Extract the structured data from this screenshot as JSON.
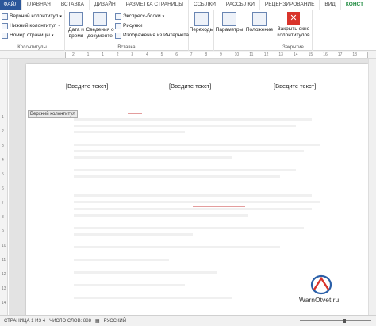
{
  "tabs": [
    "ФАЙЛ",
    "ГЛАВНАЯ",
    "ВСТАВКА",
    "ДИЗАЙН",
    "РАЗМЕТКА СТРАНИЦЫ",
    "ССЫЛКИ",
    "РАССЫЛКИ",
    "РЕЦЕНЗИРОВАНИЕ",
    "ВИД",
    "КОНСТ"
  ],
  "ribbon": {
    "kolontituly": {
      "label": "Колонтитулы",
      "items": [
        "Верхний колонтитул",
        "Нижний колонтитул",
        "Номер страницы"
      ]
    },
    "vstavka": {
      "label": "Вставка",
      "date_time": "Дата и время",
      "doc_info": "Сведения о документе",
      "express": "Экспресс-блоки",
      "pictures": "Рисунки",
      "online_images": "Изображения из Интернета"
    },
    "navigation": {
      "transitions": "Переходы"
    },
    "parameters": "Параметры",
    "position": "Положение",
    "close": {
      "label": "Закрыть окно колонтитулов",
      "group": "Закрытие"
    }
  },
  "ruler": {
    "ticks": [
      "2",
      "1",
      "1",
      "2",
      "3",
      "4",
      "5",
      "6",
      "7",
      "8",
      "9",
      "10",
      "11",
      "12",
      "13",
      "14",
      "15",
      "16",
      "17",
      "18"
    ]
  },
  "vruler": {
    "ticks": [
      "1",
      "2",
      "3",
      "4",
      "5",
      "6",
      "7",
      "8",
      "9",
      "10",
      "11",
      "12",
      "13",
      "14",
      "15"
    ]
  },
  "header": {
    "left": "[Введите текст]",
    "center": "[Введите текст]",
    "right": "[Введите текст]",
    "tag": "Верхний колонтитул"
  },
  "watermark": {
    "text": "WarnOtvet.ru"
  },
  "status": {
    "page": "СТРАНИЦА 1 ИЗ 4",
    "words": "ЧИСЛО СЛОВ: 888",
    "lang": "РУССКИЙ"
  },
  "colors": {
    "file_tab": "#2b579a",
    "contextual_tab": "#1d8a3e",
    "close_button": "#d9342b",
    "logo": "#2a5fa8"
  }
}
